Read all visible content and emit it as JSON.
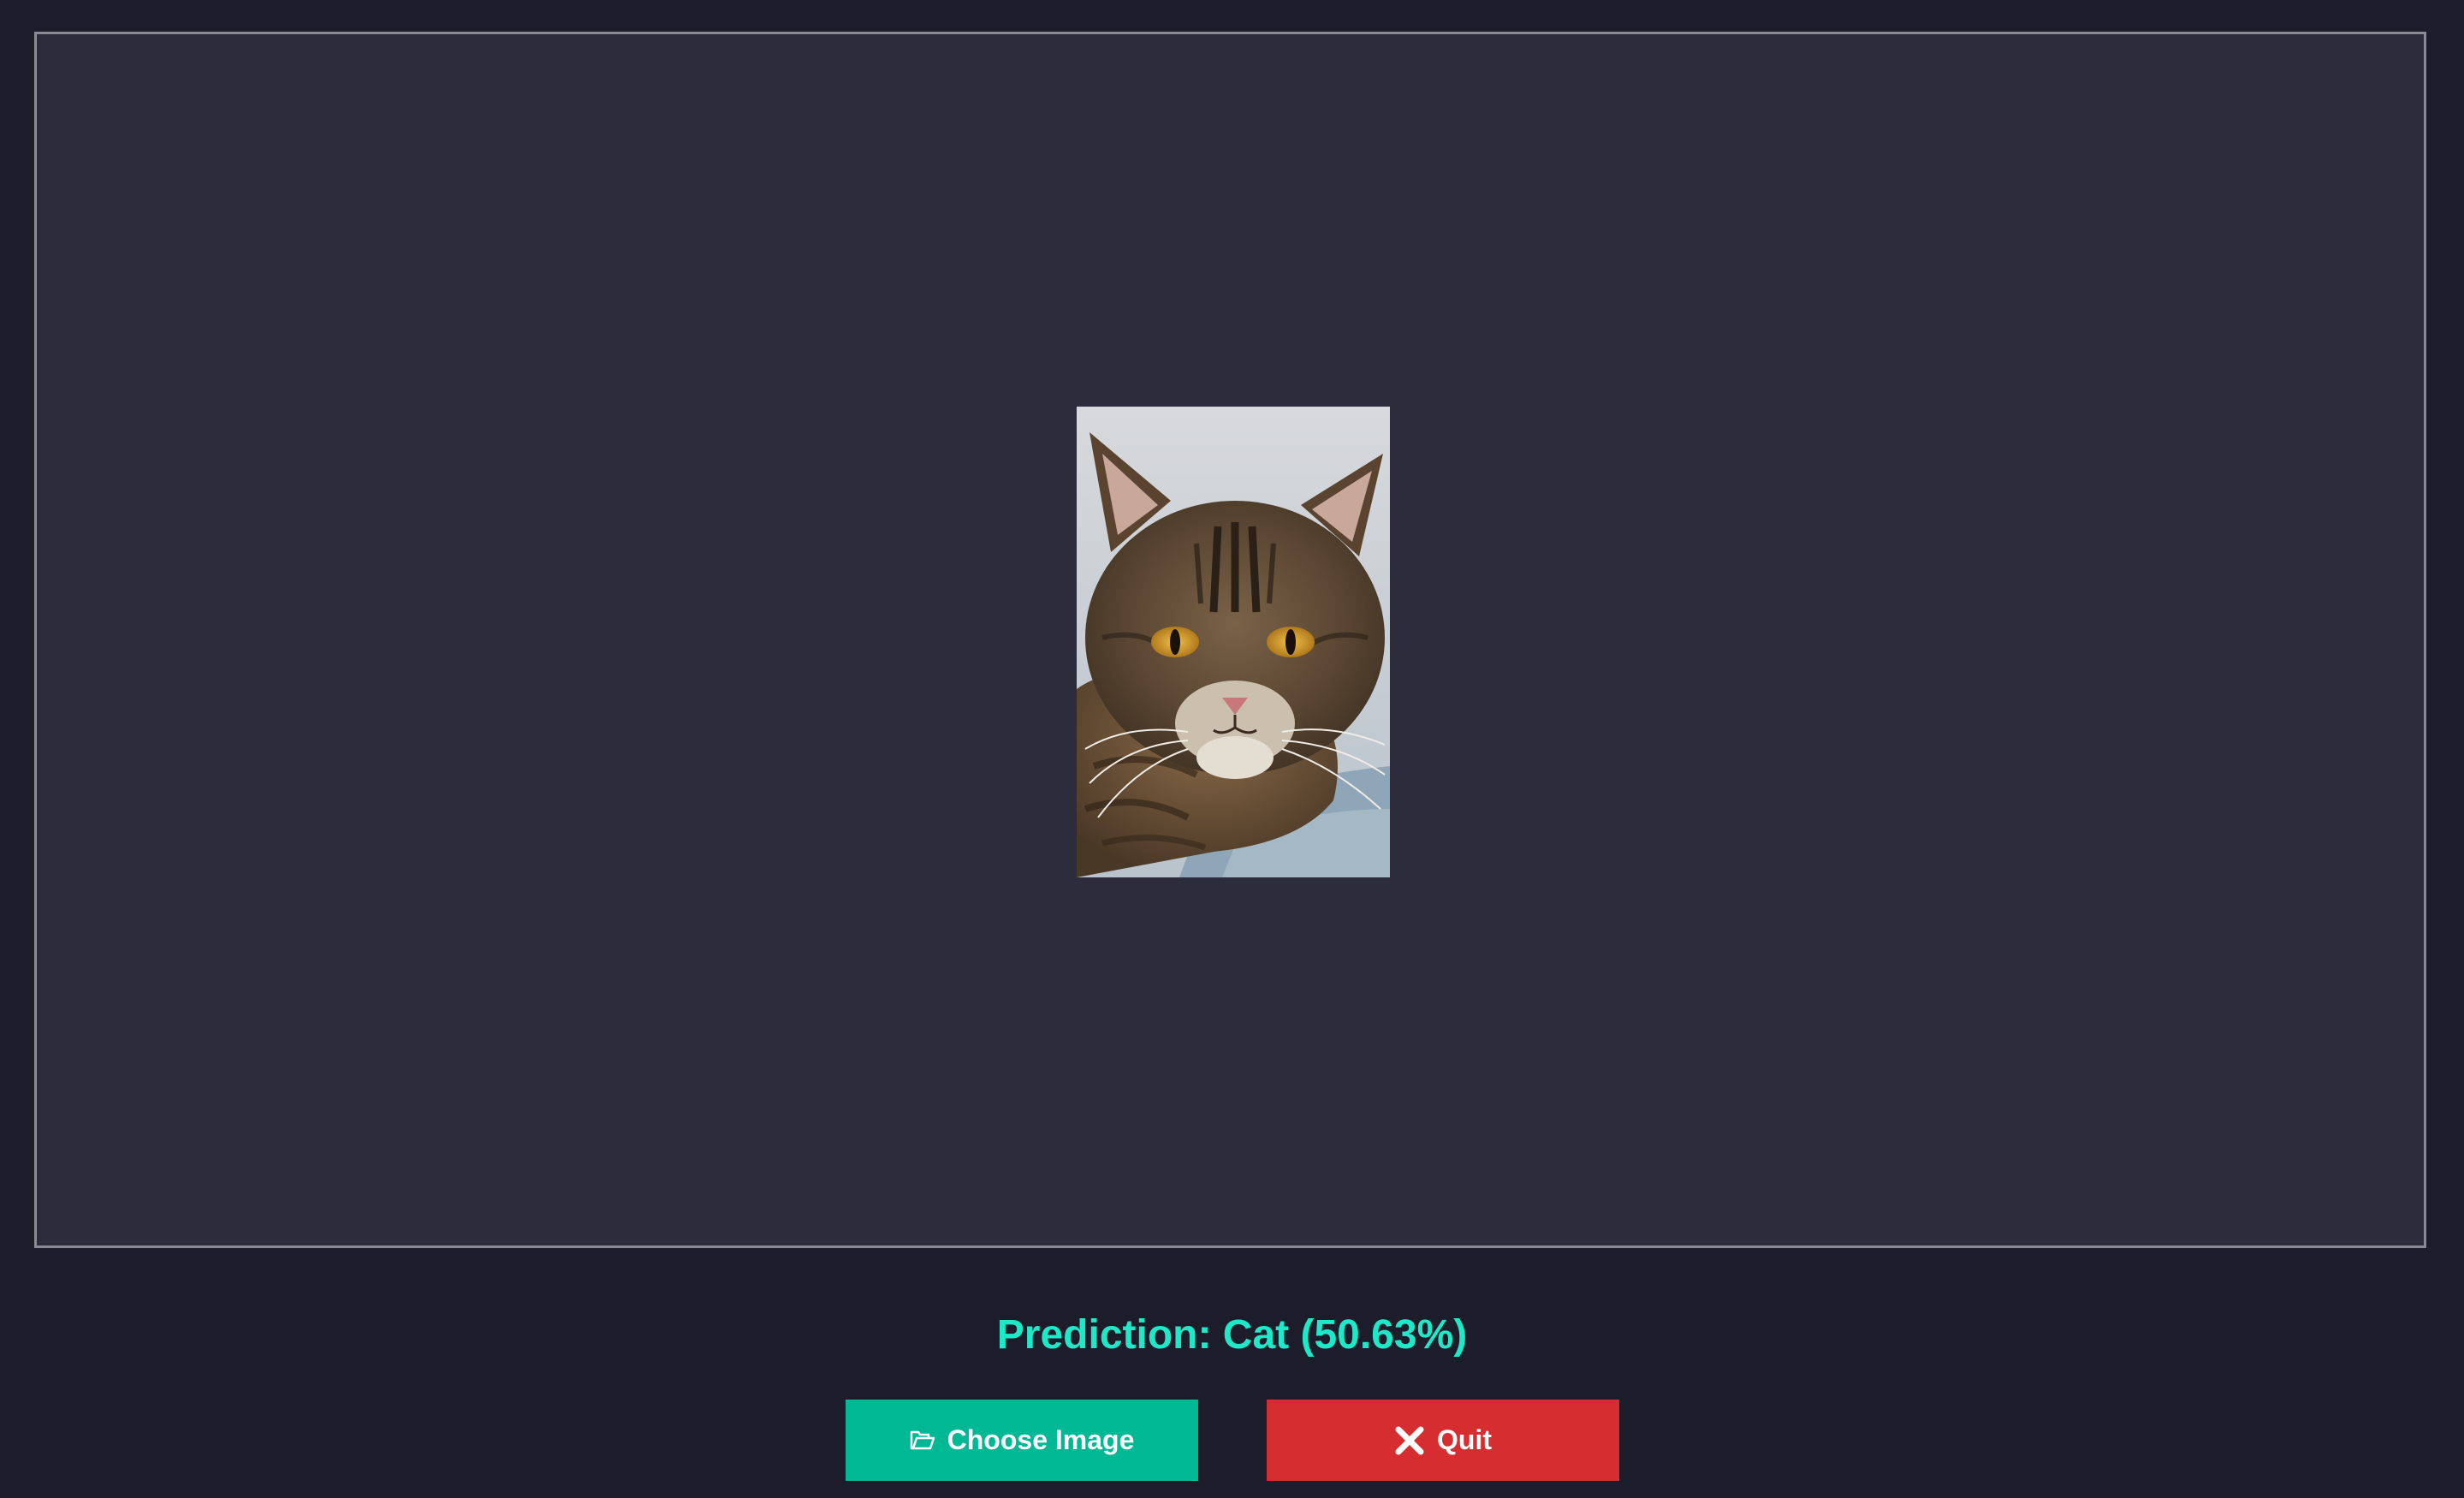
{
  "app": {
    "colors": {
      "background": "#1d1c2a",
      "panel": "#2d2c3c",
      "panel_border": "#8a8a94",
      "prediction_text": "#1de9c8",
      "choose_button": "#00b894",
      "quit_button": "#d62e30"
    }
  },
  "preview": {
    "subject": "cat"
  },
  "result": {
    "prediction_text": "Prediction: Cat (50.63%)"
  },
  "buttons": {
    "choose": {
      "label": "Choose Image",
      "icon": "folder-open-icon"
    },
    "quit": {
      "label": "Quit",
      "icon": "close-icon"
    }
  }
}
